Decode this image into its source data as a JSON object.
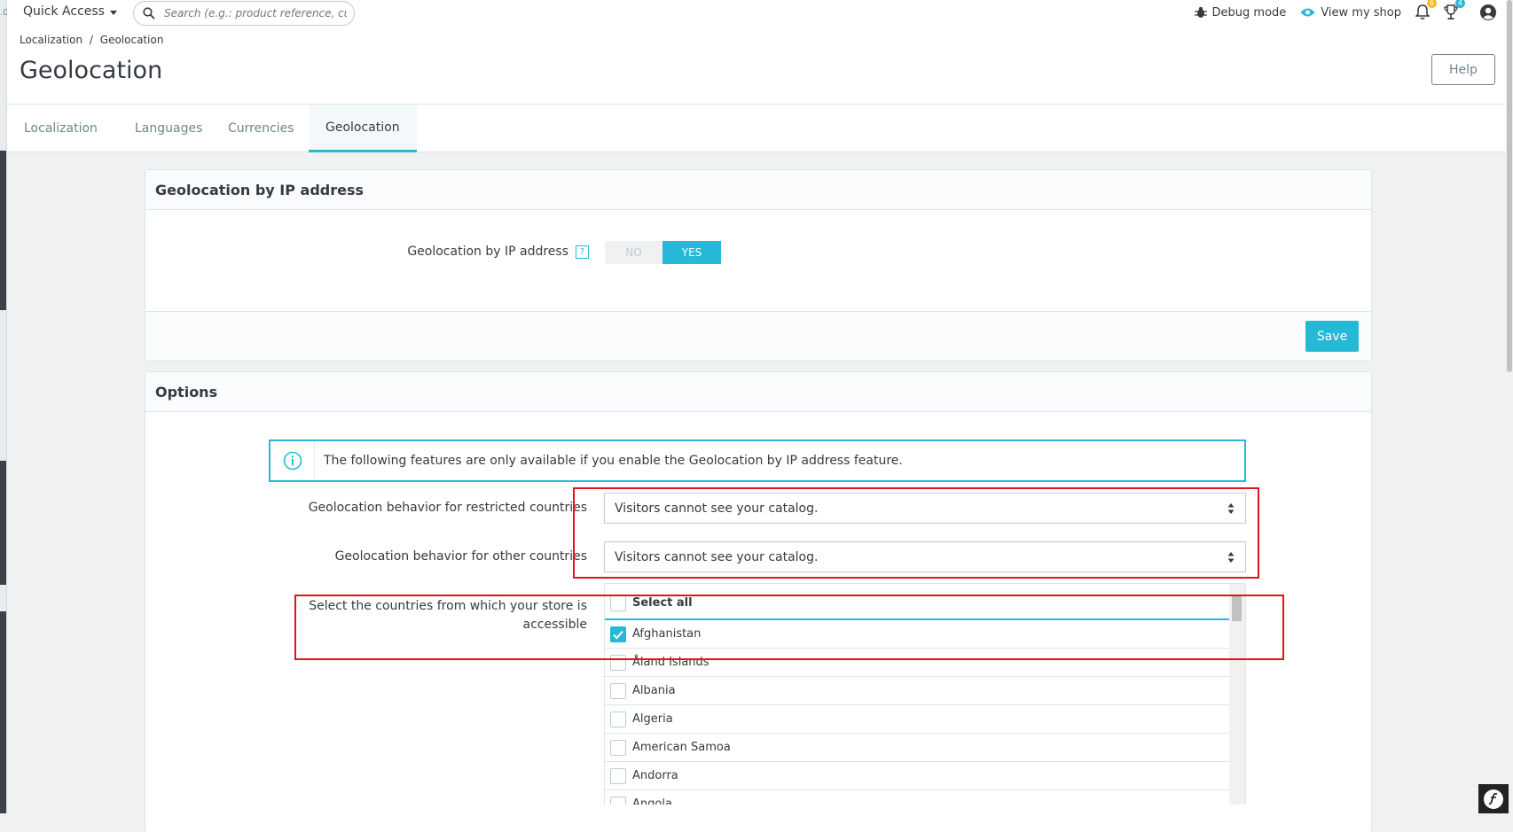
{
  "topbar": {
    "version_text": ".0",
    "quick_access_label": "Quick Access",
    "search_placeholder": "Search (e.g.: product reference, custome",
    "debug_mode_label": "Debug mode",
    "view_shop_label": "View my shop",
    "notifications_count": "6",
    "trophy_count": "4",
    "colors": {
      "notification_badge": "#fbbb22",
      "trophy_badge": "#25b9d7"
    }
  },
  "header": {
    "breadcrumb": [
      "Localization",
      "Geolocation"
    ],
    "breadcrumb_separator": "/",
    "title": "Geolocation",
    "help_label": "Help"
  },
  "tabs": [
    {
      "label": "Localization",
      "active": false
    },
    {
      "label": "Languages",
      "active": false
    },
    {
      "label": "Currencies",
      "active": false
    },
    {
      "label": "Geolocation",
      "active": true
    }
  ],
  "geolocation_card": {
    "title": "Geolocation by IP address",
    "field_label": "Geolocation by IP address",
    "help_icon_text": "?",
    "switch": {
      "no_label": "NO",
      "yes_label": "YES",
      "value": "YES"
    },
    "save_label": "Save"
  },
  "options_card": {
    "title": "Options",
    "alert_text": "The following features are only available if you enable the Geolocation by IP address feature.",
    "restricted_label": "Geolocation behavior for restricted countries",
    "restricted_value": "Visitors cannot see your catalog.",
    "other_label": "Geolocation behavior for other countries",
    "other_value": "Visitors cannot see your catalog.",
    "countries_label_line1": "Select the countries from which your store is",
    "countries_label_line2": "accessible",
    "select_all_label": "Select all",
    "countries": [
      {
        "name": "Afghanistan",
        "checked": true
      },
      {
        "name": "Åland Islands",
        "checked": false
      },
      {
        "name": "Albania",
        "checked": false
      },
      {
        "name": "Algeria",
        "checked": false
      },
      {
        "name": "American Samoa",
        "checked": false
      },
      {
        "name": "Andorra",
        "checked": false
      },
      {
        "name": "Angola",
        "checked": false
      }
    ]
  },
  "colors": {
    "accent": "#25b9d7",
    "annotation_red": "#e0141e"
  }
}
